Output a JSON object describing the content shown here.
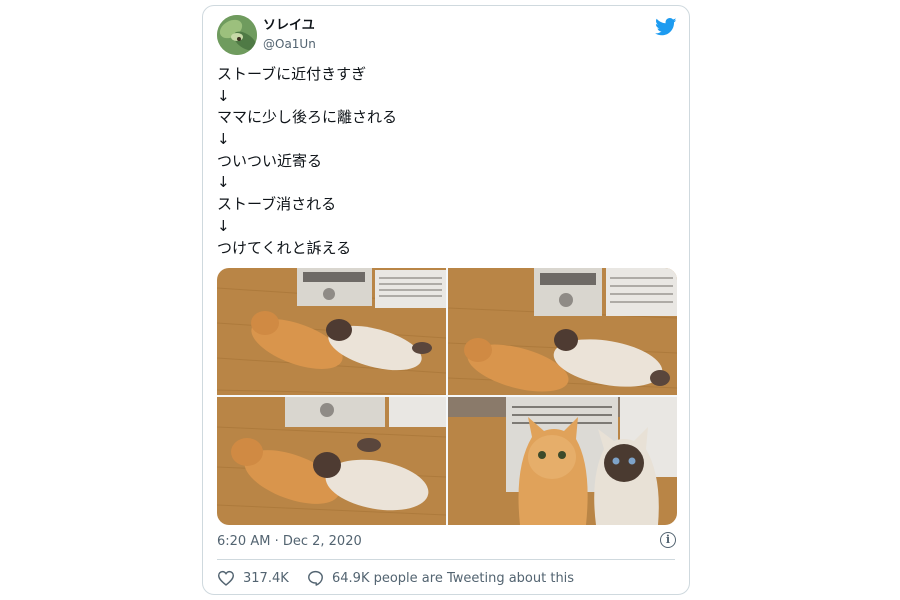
{
  "user": {
    "display_name": "ソレイユ",
    "handle": "@Oa1Un"
  },
  "tweet": {
    "lines": [
      "ストーブに近付きすぎ",
      "↓",
      "ママに少し後ろに離される",
      "↓",
      "ついつい近寄る",
      "↓",
      "ストーブ消される",
      "↓",
      "つけてくれと訴える"
    ],
    "timestamp": "6:20 AM · Dec 2, 2020",
    "likes": "317.4K",
    "comments": "64.9K people are Tweeting about this"
  },
  "icons": {
    "brand": "twitter-bird-icon",
    "info": "info-icon",
    "like": "heart-icon",
    "comment": "speech-bubble-icon"
  },
  "colors": {
    "twitter_blue": "#1d9bf0",
    "text_primary": "#0f1419",
    "text_secondary": "#536471",
    "border": "#cfd9de"
  }
}
